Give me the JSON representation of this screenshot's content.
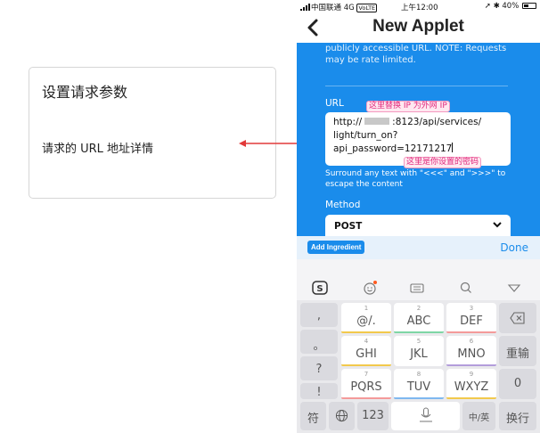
{
  "note": {
    "title": "设置请求参数",
    "text": "请求的 URL 地址详情"
  },
  "status_bar": {
    "carrier": "中国联通",
    "network": "4G",
    "volte": "VoLTE",
    "time": "上午12:00",
    "battery": "40%"
  },
  "header": {
    "title": "New Applet"
  },
  "form": {
    "description": "publicly accessible URL. NOTE: Requests may be rate limited.",
    "url_label": "URL",
    "url_line1_prefix": "http://",
    "url_line1_suffix": ":8123/api/services/",
    "url_line2": "light/turn_on?",
    "url_line3": "api_password=12171217",
    "annotation_ip": "这里替换 IP 为外网 IP",
    "annotation_pwd": "这里是你设置的密码",
    "hint": "Surround any text with \"<<<\" and \">>>\" to escape the content",
    "method_label": "Method",
    "method_value": "POST"
  },
  "ingredient_bar": {
    "add_label": "Add Ingredient",
    "done_label": "Done"
  },
  "keyboard": {
    "punct": [
      ",",
      "。",
      "?",
      "!"
    ],
    "keys": [
      {
        "num": "1",
        "label": "@/."
      },
      {
        "num": "2",
        "label": "ABC"
      },
      {
        "num": "3",
        "label": "DEF"
      },
      {
        "num": "4",
        "label": "GHI"
      },
      {
        "num": "5",
        "label": "JKL"
      },
      {
        "num": "6",
        "label": "MNO"
      },
      {
        "num": "7",
        "label": "PQRS"
      },
      {
        "num": "8",
        "label": "TUV"
      },
      {
        "num": "9",
        "label": "WXYZ"
      }
    ],
    "return_label": "重输",
    "zero_label": "0",
    "symbol_label": "符",
    "num_label": "123",
    "lang_label": "中/英",
    "newline_label": "换行"
  },
  "colors": {
    "accent": "#1a8ceb",
    "annotation_pink": "#e0277b",
    "arrow_red": "#e23a3a"
  }
}
